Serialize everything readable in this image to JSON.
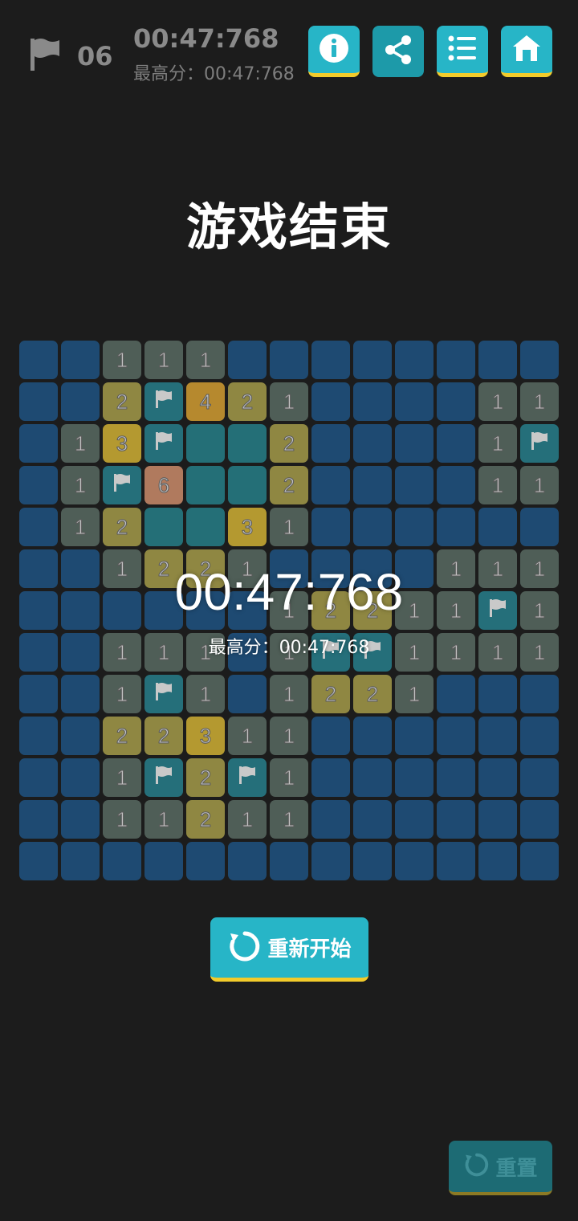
{
  "status_bar": {
    "flag_count": "06",
    "timer": "00:47:768",
    "best_score": "最高分：00:47:768"
  },
  "toolbar": {
    "info_icon": "info-icon",
    "share_icon": "share-icon",
    "list_icon": "list-icon",
    "home_icon": "home-icon"
  },
  "game_over": {
    "title": "游戏结束",
    "time": "00:47:768",
    "best_score": "最高分：00:47:768"
  },
  "board": {
    "rows": [
      [
        "H",
        "H",
        "1",
        "1",
        "1",
        "H",
        "H",
        "H",
        "H",
        "H",
        "H",
        "H",
        "H"
      ],
      [
        "H",
        "H",
        "2",
        "F",
        "4",
        "2",
        "1",
        "H",
        "H",
        "H",
        "H",
        "1",
        "1"
      ],
      [
        "H",
        "1",
        "3",
        "F",
        "O",
        "O",
        "2",
        "H",
        "H",
        "H",
        "H",
        "1",
        "F"
      ],
      [
        "H",
        "1",
        "F",
        "6",
        "O",
        "O",
        "2",
        "H",
        "H",
        "H",
        "H",
        "1",
        "1"
      ],
      [
        "H",
        "1",
        "2",
        "O",
        "O",
        "3",
        "1",
        "H",
        "H",
        "H",
        "H",
        "H",
        "H"
      ],
      [
        "H",
        "H",
        "1",
        "2",
        "2",
        "1",
        "H",
        "H",
        "H",
        "H",
        "1",
        "1",
        "1"
      ],
      [
        "H",
        "H",
        "H",
        "H",
        "H",
        "H",
        "1",
        "2",
        "2",
        "1",
        "1",
        "F",
        "1"
      ],
      [
        "H",
        "H",
        "1",
        "1",
        "1",
        "H",
        "1",
        "F",
        "F",
        "1",
        "1",
        "1",
        "1"
      ],
      [
        "H",
        "H",
        "1",
        "F",
        "1",
        "H",
        "1",
        "2",
        "2",
        "1",
        "H",
        "H",
        "H"
      ],
      [
        "H",
        "H",
        "2",
        "2",
        "3",
        "1",
        "1",
        "H",
        "H",
        "H",
        "H",
        "H",
        "H"
      ],
      [
        "H",
        "H",
        "1",
        "F",
        "2",
        "F",
        "1",
        "H",
        "H",
        "H",
        "H",
        "H",
        "H"
      ],
      [
        "H",
        "H",
        "1",
        "1",
        "2",
        "1",
        "1",
        "H",
        "H",
        "H",
        "H",
        "H",
        "H"
      ],
      [
        "H",
        "H",
        "H",
        "H",
        "H",
        "H",
        "H",
        "H",
        "H",
        "H",
        "H",
        "H",
        "H"
      ]
    ]
  },
  "actions": {
    "restart_label": "重新开始",
    "reset_label": "重置"
  },
  "colors": {
    "background": "#1c1c1c",
    "accent": "#27b5c7",
    "accent_edge": "#f2cb2b",
    "hidden_cell": "#1e4a72",
    "open_cell": "#246f77"
  }
}
